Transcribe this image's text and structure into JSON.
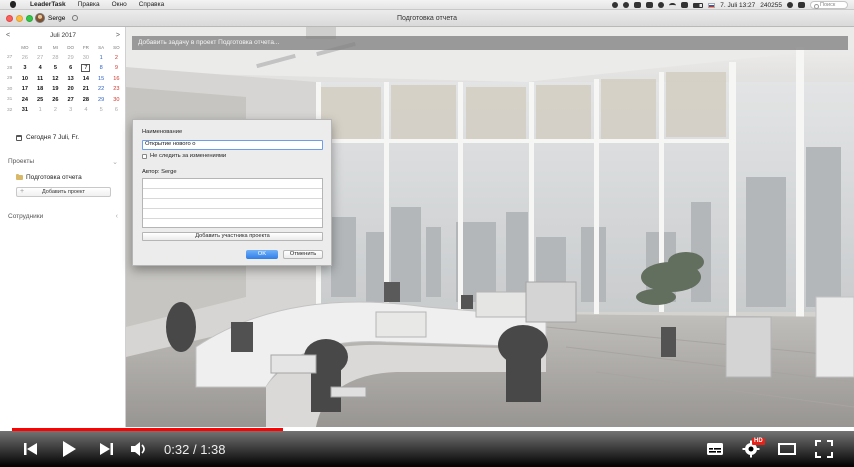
{
  "menubar": {
    "app_name": "LeaderTask",
    "menus": [
      "Правка",
      "Окно",
      "Справка"
    ],
    "clock": "7. Juli 13:27",
    "counter": "240255",
    "search_placeholder": "Поиск"
  },
  "window": {
    "title": "Подготовка отчета",
    "user_name": "Serge"
  },
  "calendar": {
    "month_label": "Juli 2017",
    "prev": "<",
    "next": ">",
    "weekdays": [
      "MO",
      "DI",
      "MI",
      "DO",
      "FR",
      "SA",
      "SO"
    ],
    "weeks": [
      {
        "wk": "27",
        "days": [
          {
            "d": "26",
            "t": "out"
          },
          {
            "d": "27",
            "t": "out"
          },
          {
            "d": "28",
            "t": "out"
          },
          {
            "d": "29",
            "t": "out"
          },
          {
            "d": "30",
            "t": "out"
          },
          {
            "d": "1",
            "t": "sat"
          },
          {
            "d": "2",
            "t": "sun"
          }
        ]
      },
      {
        "wk": "28",
        "days": [
          {
            "d": "3",
            "t": "cur"
          },
          {
            "d": "4",
            "t": "cur"
          },
          {
            "d": "5",
            "t": "cur"
          },
          {
            "d": "6",
            "t": "cur"
          },
          {
            "d": "7",
            "t": "today"
          },
          {
            "d": "8",
            "t": "sat"
          },
          {
            "d": "9",
            "t": "sun"
          }
        ]
      },
      {
        "wk": "29",
        "days": [
          {
            "d": "10",
            "t": "cur"
          },
          {
            "d": "11",
            "t": "cur"
          },
          {
            "d": "12",
            "t": "cur"
          },
          {
            "d": "13",
            "t": "cur"
          },
          {
            "d": "14",
            "t": "cur"
          },
          {
            "d": "15",
            "t": "sat"
          },
          {
            "d": "16",
            "t": "sun"
          }
        ]
      },
      {
        "wk": "30",
        "days": [
          {
            "d": "17",
            "t": "cur"
          },
          {
            "d": "18",
            "t": "cur"
          },
          {
            "d": "19",
            "t": "cur"
          },
          {
            "d": "20",
            "t": "cur"
          },
          {
            "d": "21",
            "t": "cur"
          },
          {
            "d": "22",
            "t": "sat"
          },
          {
            "d": "23",
            "t": "sun"
          }
        ]
      },
      {
        "wk": "31",
        "days": [
          {
            "d": "24",
            "t": "cur"
          },
          {
            "d": "25",
            "t": "cur"
          },
          {
            "d": "26",
            "t": "cur"
          },
          {
            "d": "27",
            "t": "cur"
          },
          {
            "d": "28",
            "t": "cur"
          },
          {
            "d": "29",
            "t": "sat"
          },
          {
            "d": "30",
            "t": "sun"
          }
        ]
      },
      {
        "wk": "32",
        "days": [
          {
            "d": "31",
            "t": "cur"
          },
          {
            "d": "1",
            "t": "out"
          },
          {
            "d": "2",
            "t": "out"
          },
          {
            "d": "3",
            "t": "out"
          },
          {
            "d": "4",
            "t": "out"
          },
          {
            "d": "5",
            "t": "out"
          },
          {
            "d": "6",
            "t": "out"
          }
        ]
      }
    ]
  },
  "sidebar": {
    "today_label": "Сегодня 7 Juli, Fr.",
    "projects_header": "Проекты",
    "project_item": "Подготовка отчета",
    "add_project": "Добавить проект",
    "employees_header": "Сотрудники"
  },
  "main": {
    "add_task_placeholder": "Добавить задачу в проект Подготовка отчета..."
  },
  "dialog": {
    "name_label": "Наименование",
    "name_value": "Открытие нового о",
    "checkbox_label": "Не следить за изменениями",
    "author_label": "Автор: Serge",
    "add_member": "Добавить участника проекта",
    "ok": "OK",
    "cancel": "Отменить"
  },
  "player": {
    "current_time": "0:32",
    "separator": "/",
    "duration": "1:38",
    "progress_fraction": 0.327,
    "buffered_fraction": 0.58,
    "hd_badge": "HD"
  },
  "colors": {
    "progress": "#ff0000",
    "ok_button": "#2f7de8",
    "sunday": "#d2332a",
    "saturday": "#2b5fc9"
  }
}
